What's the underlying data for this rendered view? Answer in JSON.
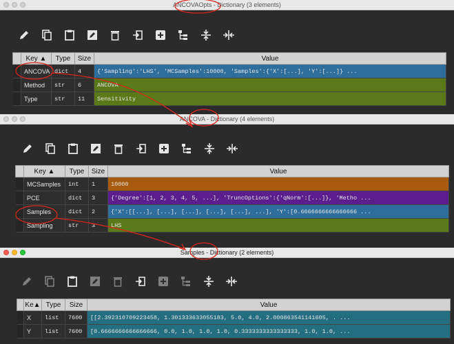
{
  "colors": {
    "accent_red": "#d9261c",
    "blue": "#2d6e9c",
    "olive": "#5a7a1a",
    "orange": "#a85a0e",
    "purple": "#5c1e8c",
    "teal": "#236e80"
  },
  "toolbar_icons": [
    "edit-icon",
    "copy-icon",
    "paste-icon",
    "rename-icon",
    "delete-icon",
    "insert-icon",
    "add-icon",
    "hierarchy-icon",
    "resize-rows-icon",
    "resize-cols-icon"
  ],
  "windows": [
    {
      "title": "ANCOVAOpts - Dictionary (3 elements)",
      "headers": {
        "key": "Key ▲",
        "type": "Type",
        "size": "Size",
        "value": "Value"
      },
      "rows": [
        {
          "key": "ANCOVA",
          "type": "dict",
          "size": "4",
          "value": "{'Sampling':'LHS', 'MCSamples':10000, 'Samples':{'X':[...], 'Y':[...]} ...",
          "color": "blue"
        },
        {
          "key": "Method",
          "type": "str",
          "size": "6",
          "value": "ANCOVA",
          "color": "olive"
        },
        {
          "key": "Type",
          "type": "str",
          "size": "11",
          "value": "Sensitivity",
          "color": "olive"
        }
      ]
    },
    {
      "title": "ANCOVA - Dictionary (4 elements)",
      "headers": {
        "key": "Key ▲",
        "type": "Type",
        "size": "Size",
        "value": "Value"
      },
      "rows": [
        {
          "key": "MCSamples",
          "type": "int",
          "size": "1",
          "value": "10000",
          "color": "orange"
        },
        {
          "key": "PCE",
          "type": "dict",
          "size": "3",
          "value": "{'Degree':[1, 2, 3, 4, 5, ...], 'TruncOptions':{'qNorm':[...]}, 'Metho ...",
          "color": "purple"
        },
        {
          "key": "Samples",
          "type": "dict",
          "size": "2",
          "value": "{'X':[[...], [...], [...], [...], [...], ...], 'Y':[0.6666666666666666 ...",
          "color": "blue"
        },
        {
          "key": "Sampling",
          "type": "str",
          "size": "3",
          "value": "LHS",
          "color": "olive"
        }
      ]
    },
    {
      "title": "Samples - Dictionary (2 elements)",
      "headers": {
        "key": "Ke▲",
        "type": "Type",
        "size": "Size",
        "value": "Value"
      },
      "rows": [
        {
          "key": "X",
          "type": "list",
          "size": "7600",
          "value": "[[2.392310709223458, 1.301333633055183, 5.0, 4.0, 2.000863541141605, . ...",
          "color": "teal"
        },
        {
          "key": "Y",
          "type": "list",
          "size": "7600",
          "value": "[0.6666666666666666, 0.0, 1.0, 1.0, 1.0, 0.3333333333333333, 1.0, 1.0, ...",
          "color": "teal"
        }
      ]
    }
  ]
}
